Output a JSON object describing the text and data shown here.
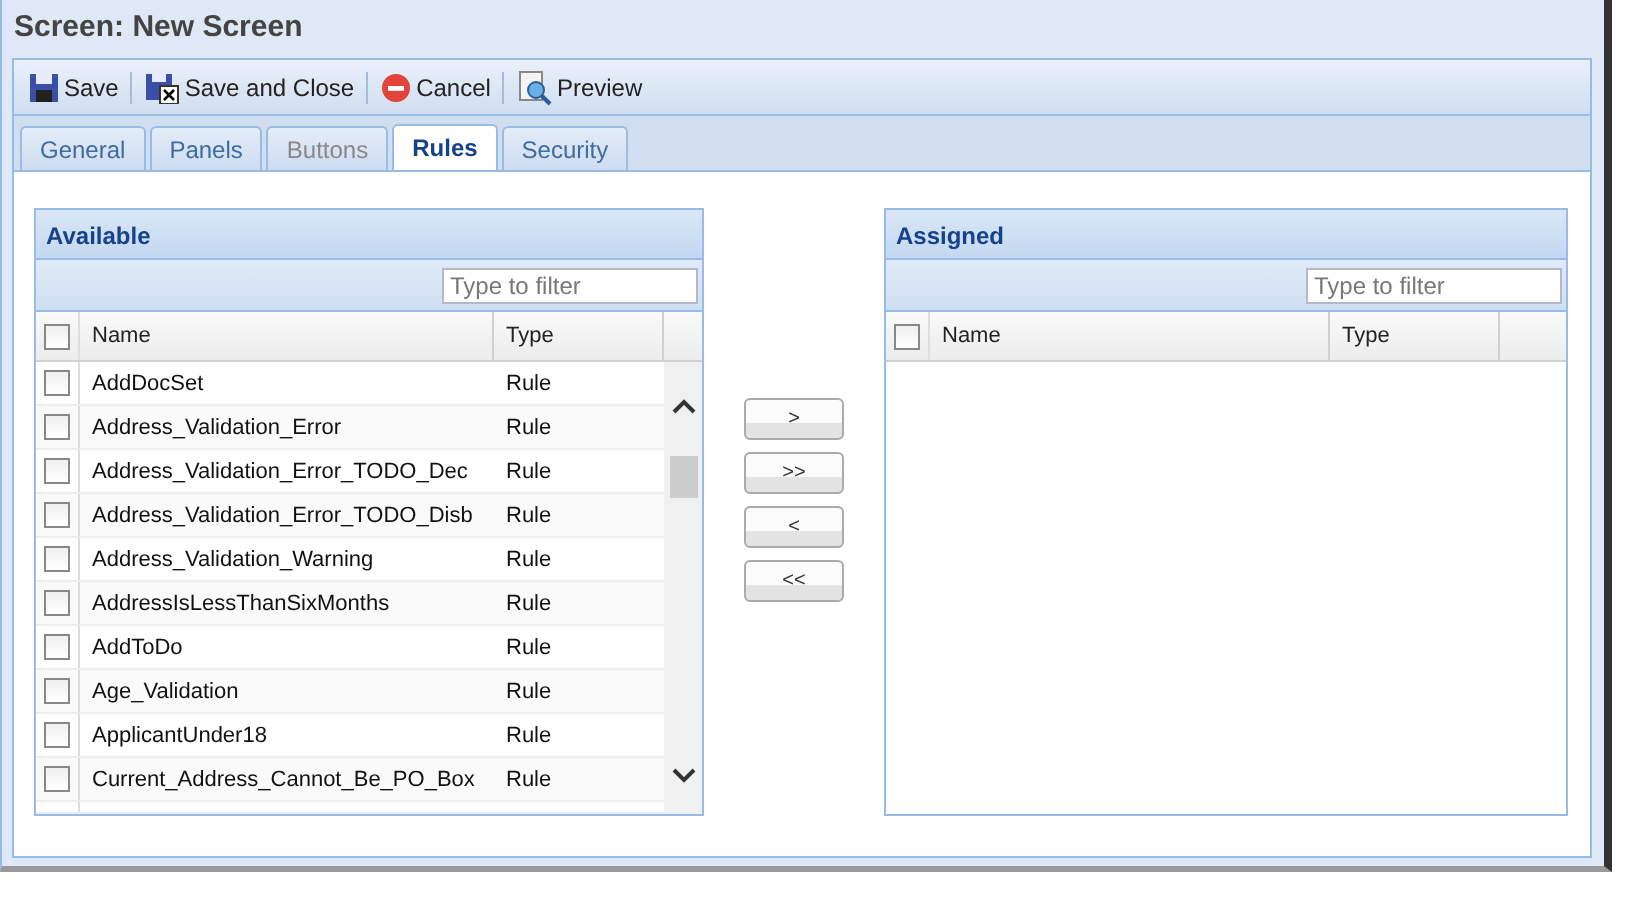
{
  "window": {
    "title": "Screen: New Screen"
  },
  "toolbar": [
    {
      "label": "Save",
      "kind": "save"
    },
    {
      "label": "Save and Close",
      "kind": "save-close"
    },
    {
      "label": "Cancel",
      "kind": "cancel"
    },
    {
      "label": "Preview",
      "kind": "preview"
    }
  ],
  "tabs": [
    {
      "label": "General",
      "selected": false,
      "disabled": false
    },
    {
      "label": "Panels",
      "selected": false,
      "disabled": false
    },
    {
      "label": "Buttons",
      "selected": false,
      "disabled": true
    },
    {
      "label": "Rules",
      "selected": true,
      "disabled": false
    },
    {
      "label": "Security",
      "selected": false,
      "disabled": false
    }
  ],
  "available": {
    "title": "Available",
    "filter": {
      "placeholder": "Type to filter"
    },
    "columns": [
      "Name",
      "Type"
    ],
    "select_all": {
      "checked": false
    },
    "rows": [
      {
        "name": "AddDocSet",
        "type": "Rule",
        "checked": false
      },
      {
        "name": "Address_Validation_Error",
        "type": "Rule",
        "checked": false
      },
      {
        "name": "Address_Validation_Error_TODO_Dec",
        "type": "Rule",
        "checked": false
      },
      {
        "name": "Address_Validation_Error_TODO_Disb",
        "type": "Rule",
        "checked": false
      },
      {
        "name": "Address_Validation_Warning",
        "type": "Rule",
        "checked": false
      },
      {
        "name": "AddressIsLessThanSixMonths",
        "type": "Rule",
        "checked": false
      },
      {
        "name": "AddToDo",
        "type": "Rule",
        "checked": false
      },
      {
        "name": "Age_Validation",
        "type": "Rule",
        "checked": false
      },
      {
        "name": "ApplicantUnder18",
        "type": "Rule",
        "checked": false
      },
      {
        "name": "Current_Address_Cannot_Be_PO_Box",
        "type": "Rule",
        "checked": false
      }
    ]
  },
  "move_buttons": [
    ">",
    ">>",
    "<",
    "<<"
  ],
  "assigned": {
    "title": "Assigned",
    "filter": {
      "placeholder": "Type to filter"
    },
    "columns": [
      "Name",
      "Type"
    ],
    "select_all": {
      "checked": false
    }
  }
}
